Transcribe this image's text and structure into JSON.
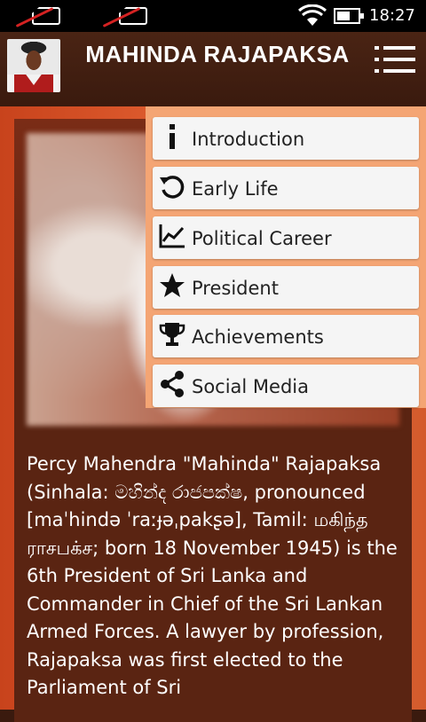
{
  "status_bar": {
    "time": "18:27",
    "icons": [
      "no-signal-icon",
      "no-signal-icon",
      "wifi-icon",
      "battery-icon"
    ]
  },
  "header": {
    "title": "MAHINDA RAJAPAKSA",
    "menu_icon": "list-menu-icon"
  },
  "menu": {
    "items": [
      {
        "label": "Introduction",
        "icon": "info-icon"
      },
      {
        "label": "Early Life",
        "icon": "history-icon"
      },
      {
        "label": "Political Career",
        "icon": "chart-icon"
      },
      {
        "label": "President",
        "icon": "star-icon"
      },
      {
        "label": "Achievements",
        "icon": "trophy-icon"
      },
      {
        "label": "Social Media",
        "icon": "share-icon"
      }
    ]
  },
  "bio": {
    "text": "Percy Mahendra \"Mahinda\" Rajapaksa (Sinhala: මහින්ද රාජපක්ෂ, pronounced [maˈhində ˈraːɟəˌpakʂə], Tamil: மகிந்த ராசபக்ச; born 18 November 1945) is the 6th President of Sri Lanka and Commander in Chief of the Sri Lankan Armed Forces. A lawyer by profession, Rajapaksa was first elected to the Parliament of Sri"
  }
}
